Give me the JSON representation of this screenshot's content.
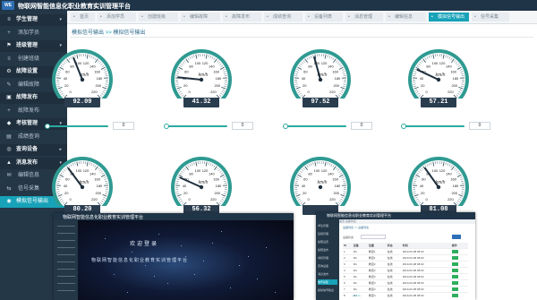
{
  "app": {
    "logo": "WE",
    "title": "物联网智能信息化职业教育实训管理平台"
  },
  "sidebar": {
    "items": [
      {
        "icon": "≡",
        "label": "学生管理",
        "type": "parent",
        "caret": "▾"
      },
      {
        "icon": "+",
        "label": "添加学员",
        "type": "child"
      },
      {
        "icon": "⚑",
        "label": "班级管理",
        "type": "parent",
        "caret": "▾"
      },
      {
        "icon": "≡",
        "label": "创建班级",
        "type": "child"
      },
      {
        "icon": "⚙",
        "label": "故障设置",
        "type": "parent",
        "caret": "▾"
      },
      {
        "icon": "✎",
        "label": "编辑故障",
        "type": "child"
      },
      {
        "icon": "▣",
        "label": "故障发布",
        "type": "parent",
        "caret": "▾"
      },
      {
        "icon": "+",
        "label": "故障发布",
        "type": "child"
      },
      {
        "icon": "◆",
        "label": "考核管理",
        "type": "parent",
        "caret": "▾"
      },
      {
        "icon": "▤",
        "label": "成绩查询",
        "type": "child"
      },
      {
        "icon": "◎",
        "label": "查询设备",
        "type": "parent",
        "caret": "▸"
      },
      {
        "icon": "▲",
        "label": "消息发布",
        "type": "parent",
        "caret": "▾"
      },
      {
        "icon": "✉",
        "label": "编辑信息",
        "type": "child"
      },
      {
        "icon": "⇆",
        "label": "信号采集",
        "type": "child"
      },
      {
        "icon": "◉",
        "label": "模拟信号输出",
        "type": "active"
      }
    ]
  },
  "tabs": [
    {
      "label": "首页"
    },
    {
      "label": "添加学员"
    },
    {
      "label": "创建班级"
    },
    {
      "label": "编辑故障"
    },
    {
      "label": "故障发布"
    },
    {
      "label": "成绩查询"
    },
    {
      "label": "设备列表"
    },
    {
      "label": "消息管理"
    },
    {
      "label": "编辑信息"
    },
    {
      "label": "模拟信号输出",
      "active": true
    },
    {
      "label": "信号采集"
    }
  ],
  "breadcrumb": {
    "parent": "模拟信号输出",
    "sep": ">>",
    "current": "模拟信号输出"
  },
  "gauges": {
    "unit": "km/h",
    "ticks": [
      "0",
      "20",
      "40",
      "60",
      "80",
      "100",
      "120",
      "140",
      "160",
      "180",
      "200",
      "220"
    ],
    "items": [
      {
        "value": "92.09",
        "input": "0"
      },
      {
        "value": "41.32",
        "input": "0"
      },
      {
        "value": "97.52",
        "input": "0"
      },
      {
        "value": "57.21",
        "input": "0"
      },
      {
        "value": "80.20",
        "input": "0"
      },
      {
        "value": "56.32",
        "input": "0"
      },
      {
        "value": "",
        "input": ""
      },
      {
        "value": "81.08",
        "input": "0"
      }
    ]
  },
  "overlay_login": {
    "title": "物联网智能信息化职业教育实训管理平台",
    "welcome": "欢迎登录",
    "subtitle": "物联网智能信息化职业教育实训管理平台"
  },
  "overlay_table": {
    "title": "物联网智能信息化职业教育实训管理平台",
    "tabs": "首页   设备列表",
    "breadcrumb": "设备列表 >> 设备列表",
    "filter_label": "设备状态",
    "columns": [
      "ID",
      "设备",
      "位置",
      "状态",
      "时间",
      "操作"
    ],
    "rows": [
      [
        "1",
        "ZG",
        "教室1",
        "在线",
        "2019-03-08 08:00"
      ],
      [
        "2",
        "ZG",
        "教室1",
        "在线",
        "2019-03-08 08:00"
      ],
      [
        "3",
        "ZG",
        "教室2",
        "在线",
        "2019-03-08 08:00"
      ],
      [
        "4",
        "ZG",
        "教室2",
        "在线",
        "2019-03-08 08:00"
      ],
      [
        "5",
        "ZG",
        "教室3",
        "在线",
        "2019-03-08 08:00"
      ],
      [
        "6",
        "ZG",
        "教室3",
        "在线",
        "2019-03-08 08:00"
      ],
      [
        "7",
        "ZG",
        "教室4",
        "在线",
        "2019-03-08 08:00"
      ],
      [
        "8",
        "ZG",
        "教室4",
        "在线",
        "2019-03-08 08:00"
      ]
    ],
    "side_items": [
      "学生管理",
      "班级管理",
      "故障设置",
      "故障发布",
      "考核管理",
      "查询设备",
      "消息发布",
      "信号采集",
      "模拟信号输出"
    ]
  }
}
